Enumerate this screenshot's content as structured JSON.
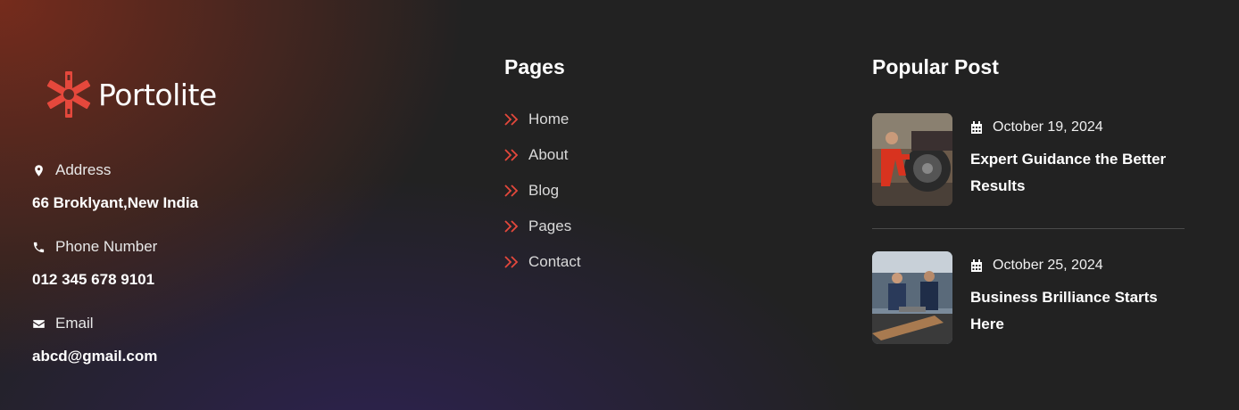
{
  "brand": {
    "name": "Portolite",
    "accent": "#e5483c"
  },
  "contact": {
    "address_label": "Address",
    "address_value": "66 Broklyant,New India",
    "phone_label": "Phone Number",
    "phone_value": "012 345 678 9101",
    "email_label": "Email",
    "email_value": "abcd@gmail.com"
  },
  "pages": {
    "title": "Pages",
    "items": [
      {
        "label": "Home"
      },
      {
        "label": "About"
      },
      {
        "label": "Blog"
      },
      {
        "label": "Pages"
      },
      {
        "label": "Contact"
      }
    ]
  },
  "popular": {
    "title": "Popular Post",
    "posts": [
      {
        "date": "October 19, 2024",
        "title": "Expert Guidance the Better Results",
        "icon": "calendar-icon"
      },
      {
        "date": "October 25, 2024",
        "title": "Business Brilliance Starts Here",
        "icon": "calendar-icon"
      }
    ]
  }
}
